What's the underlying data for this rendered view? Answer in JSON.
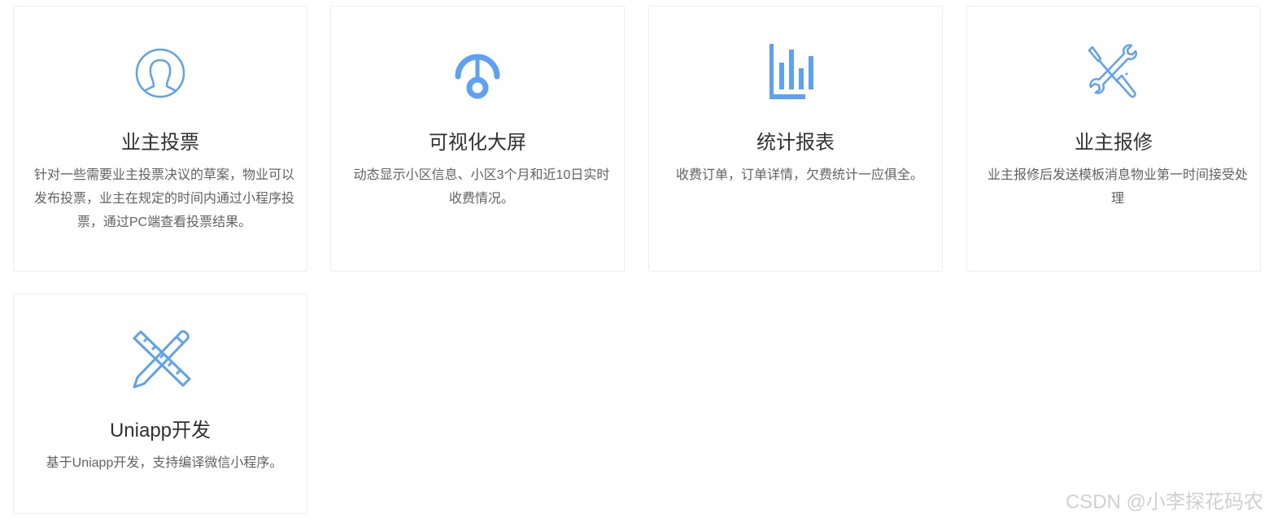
{
  "accent_color": "#5ba1f7",
  "cards": [
    {
      "icon": "user-icon",
      "title": "业主投票",
      "desc": "针对一些需要业主投票决议的草案，物业可以发布投票，业主在规定的时间内通过小程序投票，通过PC端查看投票结果。"
    },
    {
      "icon": "gauge-icon",
      "title": "可视化大屏",
      "desc": "动态显示小区信息、小区3个月和近10日实时收费情况。"
    },
    {
      "icon": "bar-chart-icon",
      "title": "统计报表",
      "desc": "收费订单，订单详情，欠费统计一应俱全。"
    },
    {
      "icon": "tools-icon",
      "title": "业主报修",
      "desc": "业主报修后发送模板消息物业第一时间接受处理"
    },
    {
      "icon": "ruler-pencil-icon",
      "title": "Uniapp开发",
      "desc": "基于Uniapp开发，支持编译微信小程序。"
    }
  ],
  "watermark": "CSDN @小李探花码农"
}
